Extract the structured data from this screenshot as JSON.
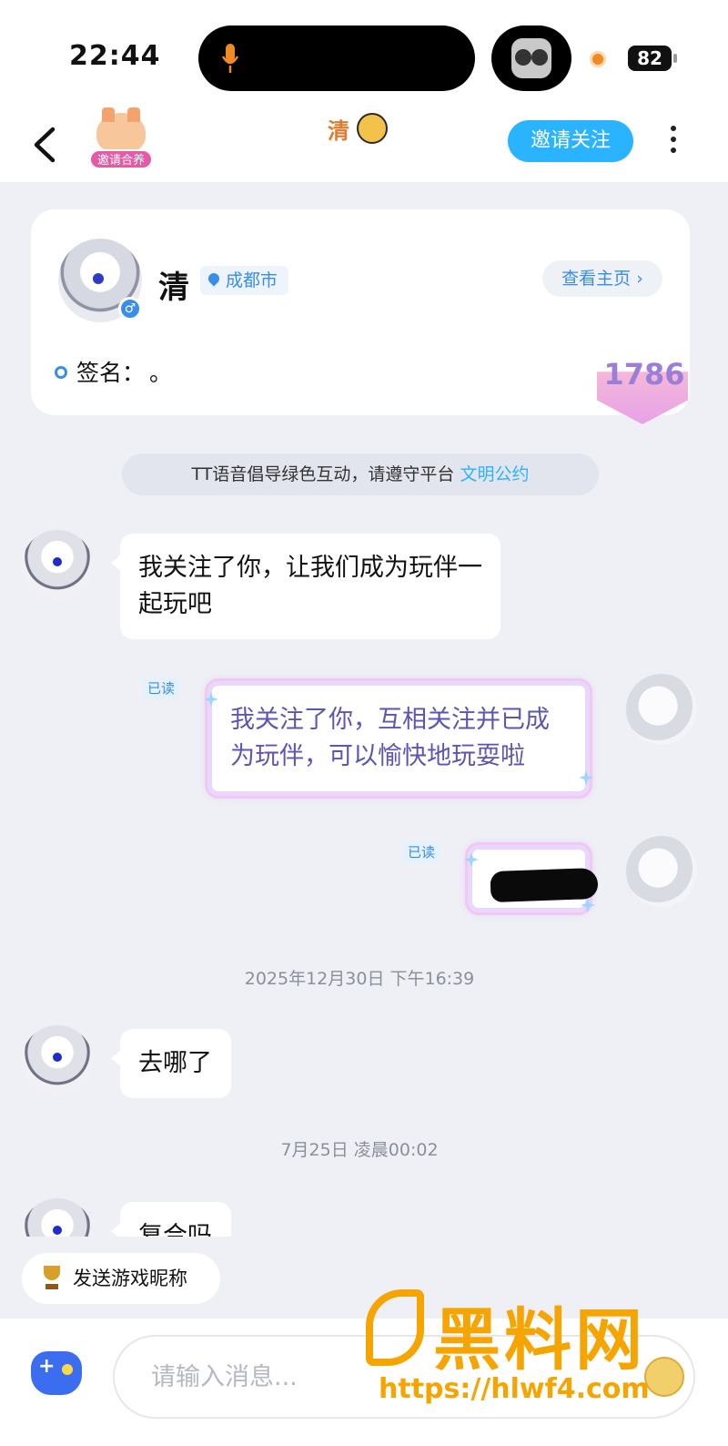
{
  "status_bar": {
    "time": "22:44",
    "battery": "82"
  },
  "nav": {
    "pet_badge": "邀请合养",
    "title": "清",
    "invite_button": "邀请关注"
  },
  "profile": {
    "name": "清",
    "location": "成都市",
    "view_home": "查看主页 ›",
    "sign_label": "签名：",
    "sign_text": "。",
    "level": "1786"
  },
  "notice": {
    "text": "TT语音倡导绿色互动，请遵守平台 ",
    "link": "文明公约"
  },
  "messages": [
    {
      "side": "in",
      "text": "我关注了你，让我们成为玩伴一起玩吧"
    },
    {
      "side": "out",
      "read": "已读",
      "text": "我关注了你，互相关注并已成为玩伴，可以愉快地玩耍啦"
    },
    {
      "side": "out",
      "read": "已读",
      "text": ""
    },
    {
      "timestamp": "2025年12月30日 下午16:39"
    },
    {
      "side": "in",
      "text": "去哪了"
    },
    {
      "timestamp": "7月25日 凌晨00:02"
    },
    {
      "side": "in",
      "text": "复合吗"
    }
  ],
  "quick_chip": {
    "label": "发送游戏昵称"
  },
  "input": {
    "placeholder": "请输入消息..."
  },
  "watermark": {
    "title": "黑料网",
    "url": "https://hlwf4.com"
  },
  "colors": {
    "accent": "#2ab4ff",
    "background": "#eff0f5",
    "brand_orange": "#f5a400"
  }
}
